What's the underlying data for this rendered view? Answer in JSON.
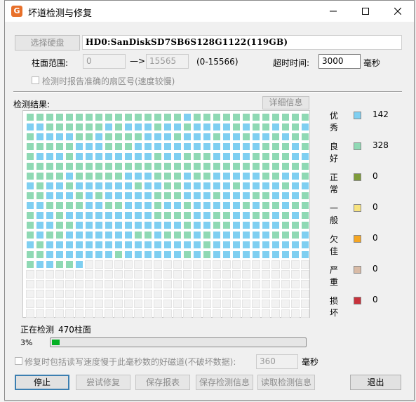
{
  "window": {
    "title": "坏道检测与修复",
    "app_icon_glyph": "G"
  },
  "top": {
    "select_disk_label": "选择硬盘",
    "disk_name": "HD0:SanDiskSD7SB6S128G1122(119GB)",
    "cylinder_range_label": "柱面范围:",
    "cylinder_from": "0",
    "arrow": "—>",
    "cylinder_to": "15565",
    "cylinder_range_hint": "(0-15566)",
    "timeout_label": "超时时间:",
    "timeout_value": "3000",
    "timeout_unit": "毫秒",
    "report_sector_label": "检测时报告准确的扇区号(速度较慢)"
  },
  "results": {
    "label": "检测结果:",
    "details_button": "详细信息",
    "total_rows": 21,
    "columns": 29,
    "blue_pattern": [
      [
        16
      ],
      [
        0,
        1,
        8,
        10,
        11,
        12,
        14,
        15,
        17,
        18,
        19,
        20,
        22,
        25,
        28
      ],
      [
        1,
        2,
        3,
        4,
        7,
        12,
        13,
        14,
        16,
        17,
        18,
        20,
        21,
        23,
        24,
        26
      ],
      [
        5,
        6,
        7,
        11,
        12,
        13,
        14,
        15,
        16,
        17,
        18,
        19,
        20,
        21,
        22,
        23,
        27
      ],
      [
        1,
        2,
        3,
        5,
        6,
        7,
        8,
        9,
        10,
        11,
        12,
        14,
        15,
        19,
        20,
        21,
        22,
        27,
        28
      ],
      [],
      [
        4,
        10,
        11,
        12,
        16,
        19,
        20,
        21,
        22,
        23,
        26,
        27
      ],
      [
        0,
        2,
        3,
        5,
        6,
        7,
        8,
        9,
        10,
        12,
        13,
        16,
        17,
        18,
        19,
        20,
        22,
        23,
        24,
        25,
        27,
        28
      ],
      [
        2,
        3,
        4,
        6,
        8,
        9,
        10,
        11,
        12,
        16,
        17,
        18,
        20,
        21,
        22,
        25,
        26,
        27
      ],
      [
        0,
        1,
        6,
        7,
        10,
        11,
        12,
        14,
        15,
        17,
        18,
        19,
        20,
        21,
        23,
        26
      ],
      [
        1,
        2,
        4,
        5,
        6,
        7,
        8,
        9,
        10,
        11,
        12,
        17,
        18,
        21,
        22,
        25,
        27
      ],
      [
        1,
        2,
        5,
        6,
        7,
        8,
        9,
        10,
        11,
        12,
        13,
        14,
        15,
        17,
        18,
        21,
        22,
        23,
        24,
        25
      ],
      [
        1,
        4,
        5,
        6,
        7,
        8,
        9,
        10,
        13,
        17,
        19,
        20,
        21,
        22,
        23,
        24,
        28
      ],
      [
        0,
        2,
        3,
        4,
        5,
        6,
        7,
        8,
        9,
        10,
        11,
        12,
        13,
        14,
        15,
        16,
        17,
        19,
        20,
        21,
        22,
        23,
        24,
        25,
        26,
        27,
        28
      ],
      [
        2,
        3,
        4,
        5,
        6,
        7,
        8,
        10,
        11,
        12,
        13,
        14,
        15,
        17,
        19,
        20,
        21,
        22,
        23,
        24,
        25,
        26,
        27,
        28
      ],
      [
        1,
        2,
        5
      ]
    ],
    "last_row_cells": 6,
    "colors": {
      "excellent": "#7fcff1",
      "good": "#8fd9b4",
      "normal": "#7f9c3a",
      "fair": "#f7e37f",
      "poor": "#f5a623",
      "serious": "#d9bba6",
      "damaged": "#c8323c",
      "empty": "#f2f2f2",
      "cell_border": "#ffffff"
    }
  },
  "legend": [
    {
      "label": "优秀",
      "count": "142",
      "color": "#7fcff1"
    },
    {
      "label": "良好",
      "count": "328",
      "color": "#8fd9b4"
    },
    {
      "label": "正常",
      "count": "0",
      "color": "#7f9c3a"
    },
    {
      "label": "一般",
      "count": "0",
      "color": "#f7e37f"
    },
    {
      "label": "欠佳",
      "count": "0",
      "color": "#f5a623"
    },
    {
      "label": "严重",
      "count": "0",
      "color": "#d9bba6"
    },
    {
      "label": "损坏",
      "count": "0",
      "color": "#c8323c"
    }
  ],
  "status": {
    "checking_label": "正在检测",
    "checking_value": "470柱面",
    "progress_text": "3%",
    "progress_fraction": 0.03
  },
  "repair": {
    "include_slow_label": "修复时包括读写速度慢于此毫秒数的好磁道(不破坏数据):",
    "threshold_value": "360",
    "threshold_unit": "毫秒"
  },
  "buttons": {
    "stop": "停止",
    "try_repair": "尝试修复",
    "save_report": "保存报表",
    "save_result": "保存检测信息",
    "load_result": "读取检测信息",
    "exit": "退出"
  }
}
